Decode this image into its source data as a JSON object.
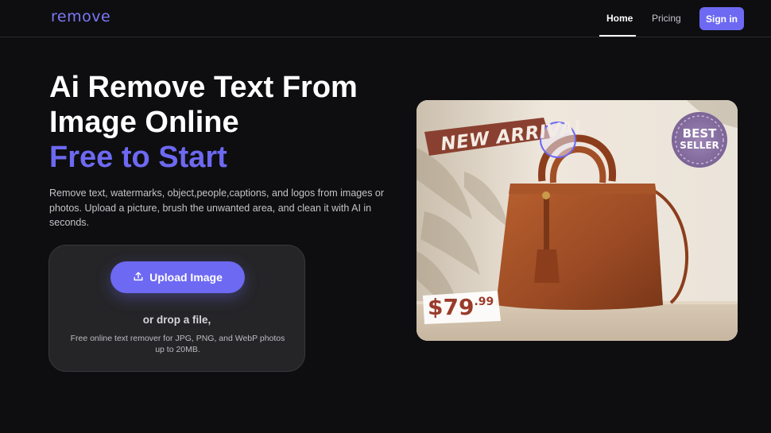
{
  "nav": {
    "logo": "remove",
    "links": [
      "Home",
      "Pricing"
    ],
    "signin_label": "Sign in"
  },
  "hero": {
    "title_line1": "Ai Remove Text From",
    "title_line2": "Image Online",
    "title_accent": "Free to Start",
    "description": "Remove text, watermarks, object,people,captions, and logos from images or photos. Upload a picture, brush the unwanted area, and clean it with AI in seconds."
  },
  "upload": {
    "button_label": "Upload Image",
    "drop_text": "or drop a file,",
    "sub_text": "Free online text remover for JPG, PNG, and WebP photos up to 20MB."
  },
  "preview": {
    "tag_text": "NEW ARRIVAL",
    "badge_line1": "BEST",
    "badge_line2": "SELLER",
    "price_main": "$79",
    "price_cents": ".99"
  },
  "colors": {
    "accent": "#6d69f2",
    "background": "#0e0e10",
    "upload_box": "#252528",
    "bag": "#9a4a24"
  },
  "icons": [
    "upload-icon"
  ]
}
